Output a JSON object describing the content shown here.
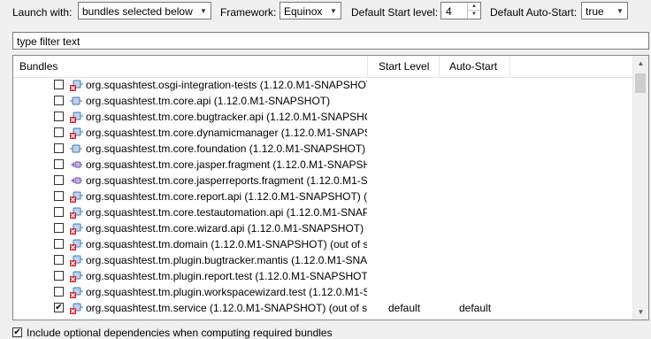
{
  "toolbar": {
    "launch_with_label": "Launch with:",
    "launch_with_value": "bundles selected below",
    "framework_label": "Framework:",
    "framework_value": "Equinox",
    "start_level_label": "Default Start level:",
    "start_level_value": "4",
    "auto_start_label": "Default Auto-Start:",
    "auto_start_value": "true"
  },
  "filter": {
    "value": "type filter text"
  },
  "table": {
    "columns": [
      "Bundles",
      "Start Level",
      "Auto-Start"
    ],
    "rows": [
      {
        "name": "org.squashtest.osgi-integration-tests (1.12.0.M1-SNAPSHOT)",
        "checked": false,
        "icon": "bundle-error-icon",
        "start_level": "",
        "auto_start": ""
      },
      {
        "name": "org.squashtest.tm.core.api (1.12.0.M1-SNAPSHOT)",
        "checked": false,
        "icon": "bundle-icon",
        "start_level": "",
        "auto_start": ""
      },
      {
        "name": "org.squashtest.tm.core.bugtracker.api (1.12.0.M1-SNAPSHOT",
        "checked": false,
        "icon": "bundle-error-icon",
        "start_level": "",
        "auto_start": ""
      },
      {
        "name": "org.squashtest.tm.core.dynamicmanager (1.12.0.M1-SNAPSH",
        "checked": false,
        "icon": "bundle-error-icon",
        "start_level": "",
        "auto_start": ""
      },
      {
        "name": "org.squashtest.tm.core.foundation (1.12.0.M1-SNAPSHOT)",
        "checked": false,
        "icon": "bundle-icon",
        "start_level": "",
        "auto_start": ""
      },
      {
        "name": "org.squashtest.tm.core.jasper.fragment (1.12.0.M1-SNAPSHC",
        "checked": false,
        "icon": "fragment-icon",
        "start_level": "",
        "auto_start": ""
      },
      {
        "name": "org.squashtest.tm.core.jasperreports.fragment (1.12.0.M1-SN",
        "checked": false,
        "icon": "fragment-icon",
        "start_level": "",
        "auto_start": ""
      },
      {
        "name": "org.squashtest.tm.core.report.api (1.12.0.M1-SNAPSHOT) (ou",
        "checked": false,
        "icon": "bundle-error-icon",
        "start_level": "",
        "auto_start": ""
      },
      {
        "name": "org.squashtest.tm.core.testautomation.api (1.12.0.M1-SNAPS",
        "checked": false,
        "icon": "bundle-error-icon",
        "start_level": "",
        "auto_start": ""
      },
      {
        "name": "org.squashtest.tm.core.wizard.api (1.12.0.M1-SNAPSHOT) (ou",
        "checked": false,
        "icon": "bundle-error-icon",
        "start_level": "",
        "auto_start": ""
      },
      {
        "name": "org.squashtest.tm.domain (1.12.0.M1-SNAPSHOT) (out of sy",
        "checked": false,
        "icon": "bundle-error-icon",
        "start_level": "",
        "auto_start": ""
      },
      {
        "name": "org.squashtest.tm.plugin.bugtracker.mantis (1.12.0.M1-SNAF",
        "checked": false,
        "icon": "bundle-error-icon",
        "start_level": "",
        "auto_start": ""
      },
      {
        "name": "org.squashtest.tm.plugin.report.test (1.12.0.M1-SNAPSHOT)",
        "checked": false,
        "icon": "bundle-error-icon",
        "start_level": "",
        "auto_start": ""
      },
      {
        "name": "org.squashtest.tm.plugin.workspacewizard.test (1.12.0.M1-SN",
        "checked": false,
        "icon": "bundle-error-icon",
        "start_level": "",
        "auto_start": ""
      },
      {
        "name": "org.squashtest.tm.service (1.12.0.M1-SNAPSHOT) (out of syn",
        "checked": true,
        "icon": "bundle-error-icon",
        "start_level": "default",
        "auto_start": "default"
      }
    ]
  },
  "include_optional": {
    "label": "Include optional dependencies when computing required bundles",
    "checked": true
  }
}
